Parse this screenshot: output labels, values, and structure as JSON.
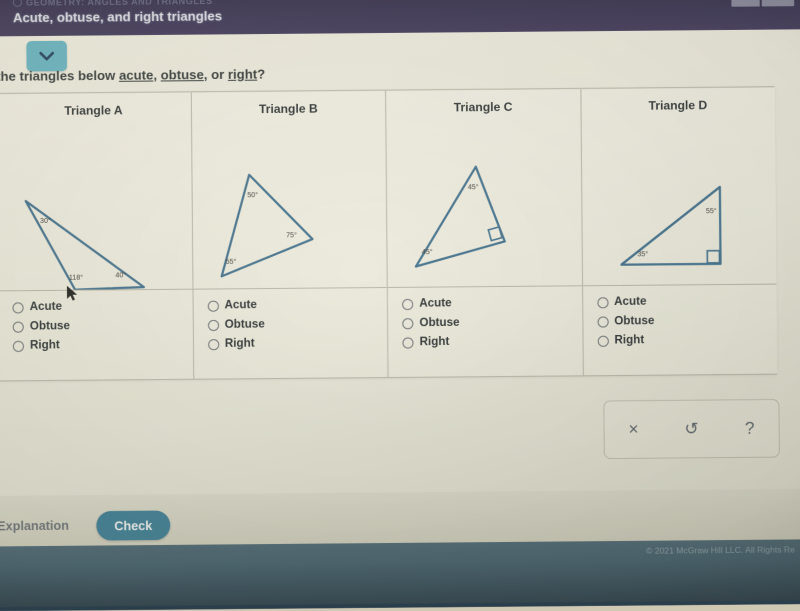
{
  "header": {
    "eyebrow": "GEOMETRY: ANGLES AND TRIANGLES",
    "title": "Acute, obtuse, and right triangles",
    "chevron_icon": "chevron-down-icon"
  },
  "question": {
    "prefix": "e the triangles below ",
    "opt1": "acute",
    "sep1": ", ",
    "opt2": "obtuse",
    "sep2": ", or ",
    "opt3": "right",
    "suffix": "?"
  },
  "options": [
    "Acute",
    "Obtuse",
    "Right"
  ],
  "triangles": [
    {
      "title": "Triangle A",
      "angles": [
        "30°",
        "118°",
        "40°"
      ],
      "right_angle": false
    },
    {
      "title": "Triangle B",
      "angles": [
        "50°",
        "55°",
        "75°"
      ],
      "right_angle": false
    },
    {
      "title": "Triangle C",
      "angles": [
        "45°",
        "45°"
      ],
      "right_angle": true
    },
    {
      "title": "Triangle D",
      "angles": [
        "55°",
        "35°"
      ],
      "right_angle": true
    }
  ],
  "toolbar": {
    "clear_label": "×",
    "undo_label": "↺",
    "help_label": "?"
  },
  "actions": {
    "explanation_label": "Explanation",
    "check_label": "Check"
  },
  "footer": {
    "copyright": "© 2021 McGraw Hill LLC. All Rights Re"
  },
  "colors": {
    "header_bg": "#332c52",
    "accent_teal": "#63b3c6",
    "check_btn": "#3d7e97",
    "triangle_stroke": "#3f6f8f",
    "footer_bg": "#3b5563"
  }
}
